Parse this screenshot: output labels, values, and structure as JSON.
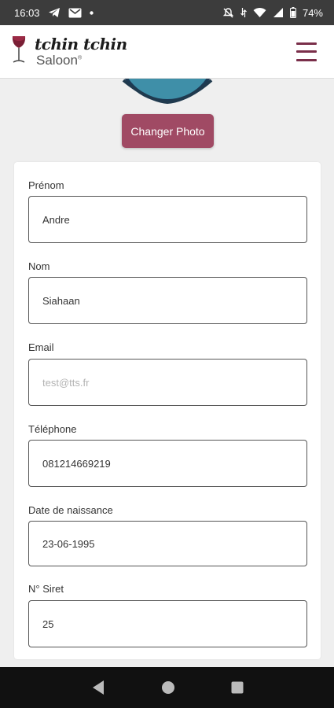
{
  "status_bar": {
    "time": "16:03",
    "battery": "74%",
    "icons": [
      "telegram-icon",
      "gmail-icon",
      "dot-icon",
      "mute-icon",
      "data-icon",
      "wifi-icon",
      "signal-icon",
      "battery-icon"
    ]
  },
  "header": {
    "logo_main": "tchin tchin",
    "logo_sub": "Saloon",
    "logo_mark": "®",
    "menu_icon": "hamburger-icon",
    "accent_color": "#7a2f4a"
  },
  "profile": {
    "change_photo_label": "Changer Photo",
    "button_color": "#a04a64"
  },
  "form": {
    "fields": [
      {
        "label": "Prénom",
        "value": "Andre",
        "placeholder": ""
      },
      {
        "label": "Nom",
        "value": "Siahaan",
        "placeholder": ""
      },
      {
        "label": "Email",
        "value": "",
        "placeholder": "test@tts.fr"
      },
      {
        "label": "Téléphone",
        "value": "081214669219",
        "placeholder": ""
      },
      {
        "label": "Date de naissance",
        "value": "23-06-1995",
        "placeholder": ""
      },
      {
        "label": "N° Siret",
        "value": "25",
        "placeholder": ""
      }
    ]
  },
  "nav_bar": {
    "icons": [
      "back-icon",
      "home-icon",
      "recents-icon"
    ]
  }
}
